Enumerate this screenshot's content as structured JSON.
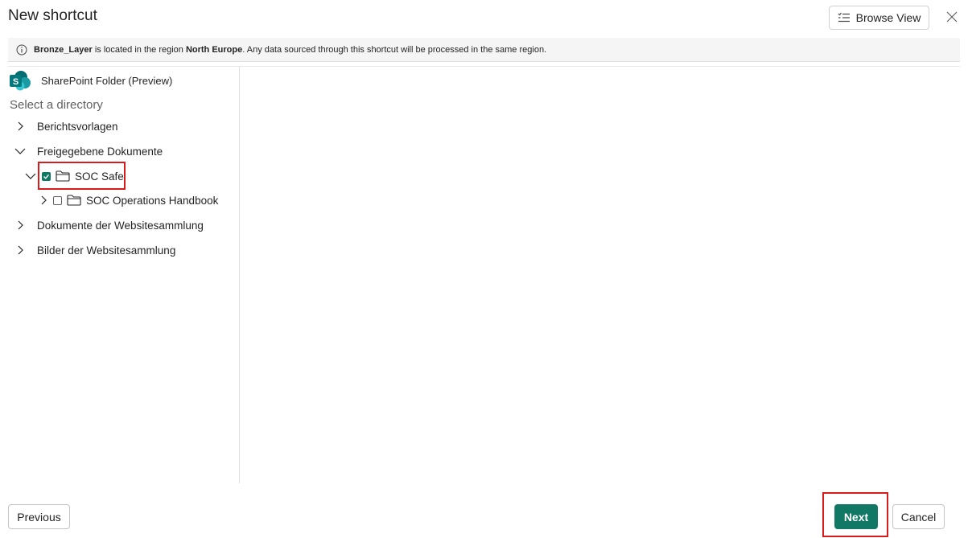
{
  "header": {
    "title": "New shortcut",
    "browse_view_label": "Browse View"
  },
  "info_bar": {
    "lakehouse": "Bronze_Layer",
    "text_before_region": " is located in the region ",
    "region": "North Europe",
    "text_after_region": ". Any data sourced through this shortcut will be processed in the same region."
  },
  "source": {
    "name": "SharePoint Folder (Preview)",
    "logo_letter": "S"
  },
  "directory": {
    "label": "Select a directory",
    "items": [
      {
        "label": "Berichtsvorlagen",
        "expanded": false
      },
      {
        "label": "Freigegebene Dokumente",
        "expanded": true
      },
      {
        "label": "SOC Safe",
        "expanded": true,
        "checked": true
      },
      {
        "label": "SOC Operations Handbook",
        "expanded": false,
        "checked": false
      },
      {
        "label": "Dokumente der Websitesammlung",
        "expanded": false
      },
      {
        "label": "Bilder der Websitesammlung",
        "expanded": false
      }
    ]
  },
  "footer": {
    "previous_label": "Previous",
    "next_label": "Next",
    "cancel_label": "Cancel"
  },
  "colors": {
    "accent": "#117865",
    "highlight": "#d81b1b",
    "sharepoint_teal": "#038387"
  }
}
